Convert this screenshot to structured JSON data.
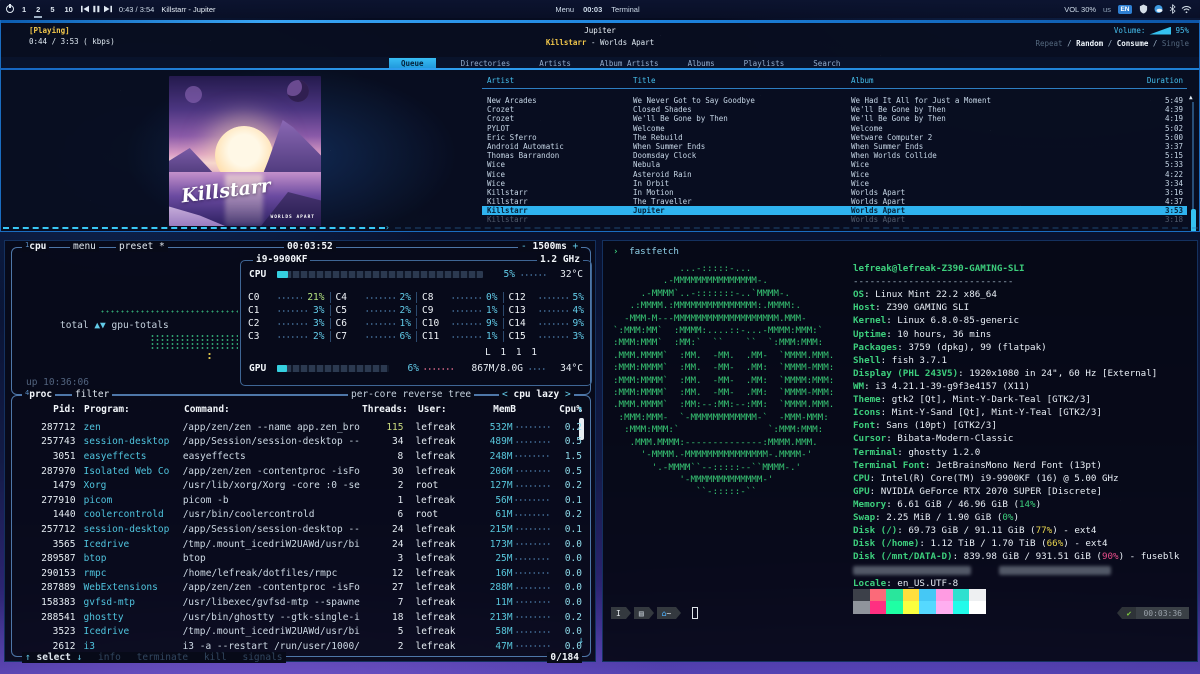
{
  "colors": {
    "accent_blue": "#2f9ff0",
    "cyan": "#46c0ee",
    "yellow": "#f3c84b",
    "mint_green": "#3dcf7d",
    "selected_row_bg": "#2fb3ef"
  },
  "topbar": {
    "workspaces": [
      "1",
      "2",
      "5",
      "10"
    ],
    "active_workspace": "2",
    "media_time": "0:43 / 3:54",
    "media_track": "Killstarr - Jupiter",
    "menu_label": "Menu",
    "clock": "00:03",
    "focused_window": "Terminal",
    "volume_label": "VOL 30%",
    "kb_layout": "us",
    "lang_badge": "EN"
  },
  "player": {
    "status": "[Playing]",
    "elapsed": "0:44 / 3:53 ( kbps)",
    "title": "Jupiter",
    "artist": "Killstarr",
    "separator": " - ",
    "album": "Worlds Apart",
    "volume_label": "Volume:",
    "volume_value": "95%",
    "toggles": [
      {
        "label": "Repeat",
        "active": false
      },
      {
        "label": "Random",
        "active": true
      },
      {
        "label": "Consume",
        "active": true
      },
      {
        "label": "Single",
        "active": false
      }
    ],
    "tabs": [
      {
        "label": "Queue",
        "selected": true
      },
      {
        "label": "Directories",
        "selected": false
      },
      {
        "label": "Artists",
        "selected": false
      },
      {
        "label": "Album Artists",
        "selected": false
      },
      {
        "label": "Albums",
        "selected": false
      },
      {
        "label": "Playlists",
        "selected": false
      },
      {
        "label": "Search",
        "selected": false
      }
    ],
    "columns": [
      "Artist",
      "Title",
      "Album",
      "Duration"
    ],
    "rows": [
      {
        "artist": "New Arcades",
        "title": "We Never Got to Say Goodbye",
        "album": "We Had It All for Just a Moment",
        "duration": "5:49",
        "selected": false,
        "partial": false
      },
      {
        "artist": "Crozet",
        "title": "Closed Shades",
        "album": "We'll Be Gone by Then",
        "duration": "4:39",
        "selected": false,
        "partial": false
      },
      {
        "artist": "Crozet",
        "title": "We'll Be Gone by Then",
        "album": "We'll Be Gone by Then",
        "duration": "4:19",
        "selected": false,
        "partial": false
      },
      {
        "artist": "PYLOT",
        "title": "Welcome",
        "album": "Welcome",
        "duration": "5:02",
        "selected": false,
        "partial": false
      },
      {
        "artist": "Eric Sferro",
        "title": "The Rebuild",
        "album": "Wetware Computer 2",
        "duration": "5:00",
        "selected": false,
        "partial": false
      },
      {
        "artist": "Android Automatic",
        "title": "When Summer Ends",
        "album": "When Summer Ends",
        "duration": "3:37",
        "selected": false,
        "partial": false
      },
      {
        "artist": "Thomas Barrandon",
        "title": "Doomsday Clock",
        "album": "When Worlds Collide",
        "duration": "5:15",
        "selected": false,
        "partial": false
      },
      {
        "artist": "Wice",
        "title": "Nebula",
        "album": "Wice",
        "duration": "5:33",
        "selected": false,
        "partial": false
      },
      {
        "artist": "Wice",
        "title": "Asteroid Rain",
        "album": "Wice",
        "duration": "4:22",
        "selected": false,
        "partial": false
      },
      {
        "artist": "Wice",
        "title": "In Orbit",
        "album": "Wice",
        "duration": "3:34",
        "selected": false,
        "partial": false
      },
      {
        "artist": "Killstarr",
        "title": "In Motion",
        "album": "Worlds Apart",
        "duration": "3:16",
        "selected": false,
        "partial": false
      },
      {
        "artist": "Killstarr",
        "title": "The Traveller",
        "album": "Worlds Apart",
        "duration": "4:37",
        "selected": false,
        "partial": false
      },
      {
        "artist": "Killstarr",
        "title": "Jupiter",
        "album": "Worlds Apart",
        "duration": "3:53",
        "selected": true,
        "partial": false
      },
      {
        "artist": "Killstarr",
        "title": "",
        "album": "Worlds Apart",
        "duration": "3:18",
        "selected": false,
        "partial": true
      }
    ],
    "art": {
      "script": "Killstarr",
      "caption": "WORLDS APART"
    }
  },
  "btop": {
    "cpu_box": {
      "index": "1",
      "title": "cpu",
      "menu": "menu",
      "preset": "preset *",
      "clock": "00:03:52",
      "interval_minus": "-",
      "interval": "1500ms",
      "interval_plus": "+",
      "model": "i9-9900KF",
      "freq": "1.2 GHz",
      "cpu_label": "CPU",
      "cpu_pct": "5%",
      "cpu_temp": "32°C",
      "core_rows": [
        [
          {
            "n": "C0",
            "p": "21%"
          },
          {
            "n": "C4",
            "p": "2%"
          },
          {
            "n": "C8",
            "p": "0%"
          },
          {
            "n": "C12",
            "p": "5%"
          }
        ],
        [
          {
            "n": "C1",
            "p": "3%"
          },
          {
            "n": "C5",
            "p": "2%"
          },
          {
            "n": "C9",
            "p": "1%"
          },
          {
            "n": "C13",
            "p": "4%"
          }
        ],
        [
          {
            "n": "C2",
            "p": "3%"
          },
          {
            "n": "C6",
            "p": "1%"
          },
          {
            "n": "C10",
            "p": "9%"
          },
          {
            "n": "C14",
            "p": "9%"
          }
        ],
        [
          {
            "n": "C3",
            "p": "2%"
          },
          {
            "n": "C7",
            "p": "6%"
          },
          {
            "n": "C11",
            "p": "1%"
          },
          {
            "n": "C15",
            "p": "3%"
          }
        ]
      ],
      "load_avg": "L 1 1 1",
      "gpu_label": "GPU",
      "gpu_pct": "6%",
      "gpu_mem": "867M/8.0G",
      "gpu_temp": "34°C",
      "graph_label_pre": "total ",
      "graph_arrows": "▲▼",
      "graph_label_post": " gpu-totals",
      "uptime": "up 10:36:06"
    },
    "proc_box": {
      "index": "4",
      "title": "proc",
      "filter": "filter",
      "options": "per-core   reverse   tree",
      "sort_prev": "<",
      "sort": "cpu lazy",
      "sort_next": ">",
      "sort_arrow": "↑",
      "columns": {
        "pid": "Pid:",
        "program": "Program:",
        "command": "Command:",
        "threads": "Threads:",
        "user": "User:",
        "mem": "MemB",
        "cpu": "Cpu%"
      },
      "rows": [
        {
          "pid": "287712",
          "prog": "zen",
          "cmd": "/app/zen/zen --name app.zen_bro",
          "thr": "115",
          "user": "lefreak",
          "mem": "532M",
          "cpu": "0.2"
        },
        {
          "pid": "257743",
          "prog": "session-desktop",
          "cmd": "/app/Session/session-desktop --",
          "thr": "34",
          "user": "lefreak",
          "mem": "489M",
          "cpu": "0.5"
        },
        {
          "pid": "3051",
          "prog": "easyeffects",
          "cmd": "easyeffects",
          "thr": "8",
          "user": "lefreak",
          "mem": "248M",
          "cpu": "1.5"
        },
        {
          "pid": "287970",
          "prog": "Isolated Web Co",
          "cmd": "/app/zen/zen -contentproc -isFo",
          "thr": "30",
          "user": "lefreak",
          "mem": "206M",
          "cpu": "0.5"
        },
        {
          "pid": "1479",
          "prog": "Xorg",
          "cmd": "/usr/lib/xorg/Xorg -core :0 -se",
          "thr": "2",
          "user": "root",
          "mem": "127M",
          "cpu": "0.2"
        },
        {
          "pid": "277910",
          "prog": "picom",
          "cmd": "picom -b",
          "thr": "1",
          "user": "lefreak",
          "mem": "56M",
          "cpu": "0.1"
        },
        {
          "pid": "1440",
          "prog": "coolercontrold",
          "cmd": "/usr/bin/coolercontrold",
          "thr": "6",
          "user": "root",
          "mem": "61M",
          "cpu": "0.2"
        },
        {
          "pid": "257712",
          "prog": "session-desktop",
          "cmd": "/app/Session/session-desktop --",
          "thr": "24",
          "user": "lefreak",
          "mem": "215M",
          "cpu": "0.1"
        },
        {
          "pid": "3565",
          "prog": "Icedrive",
          "cmd": "/tmp/.mount_icedriW2UAWd/usr/bi",
          "thr": "24",
          "user": "lefreak",
          "mem": "173M",
          "cpu": "0.0"
        },
        {
          "pid": "289587",
          "prog": "btop",
          "cmd": "btop",
          "thr": "3",
          "user": "lefreak",
          "mem": "25M",
          "cpu": "0.0"
        },
        {
          "pid": "290153",
          "prog": "rmpc",
          "cmd": "/home/lefreak/dotfiles/rmpc",
          "thr": "12",
          "user": "lefreak",
          "mem": "16M",
          "cpu": "0.0"
        },
        {
          "pid": "287889",
          "prog": "WebExtensions",
          "cmd": "/app/zen/zen -contentproc -isFo",
          "thr": "27",
          "user": "lefreak",
          "mem": "288M",
          "cpu": "0.0"
        },
        {
          "pid": "158383",
          "prog": "gvfsd-mtp",
          "cmd": "/usr/libexec/gvfsd-mtp --spawne",
          "thr": "7",
          "user": "lefreak",
          "mem": "11M",
          "cpu": "0.0"
        },
        {
          "pid": "288541",
          "prog": "ghostty",
          "cmd": "/usr/bin/ghostty --gtk-single-i",
          "thr": "18",
          "user": "lefreak",
          "mem": "213M",
          "cpu": "0.2"
        },
        {
          "pid": "3523",
          "prog": "Icedrive",
          "cmd": "/tmp/.mount_icedriW2UAWd/usr/bi",
          "thr": "5",
          "user": "lefreak",
          "mem": "58M",
          "cpu": "0.0"
        },
        {
          "pid": "2612",
          "prog": "i3",
          "cmd": "i3 -a --restart /run/user/1000/",
          "thr": "2",
          "user": "lefreak",
          "mem": "47M",
          "cpu": "0.0"
        }
      ],
      "footer": {
        "up": "↑",
        "select": "select",
        "down": "↓",
        "actions": [
          "info",
          "terminate",
          "kill",
          "signals"
        ],
        "count": "0/184"
      }
    }
  },
  "fastfetch": {
    "prompt_symbol": "›",
    "prompt_cmd": "fastfetch",
    "logo_lines": [
      "            ...-:::::-...",
      "         .-MMMMMMMMMMMMMMM-.",
      "     .-MMMM`..-:::::::-..`MMMM-.",
      "   .:MMMM.:MMMMMMMMMMMMMMM:.MMMM:.",
      "  -MMM-M---MMMMMMMMMMMMMMMMMMM.MMM-",
      "`:MMM:MM`  :MMMM:....::-...-MMMM:MMM:`",
      ":MMM:MMM`  :MM:`  ``    ``  `:MMM:MMM:",
      ".MMM.MMMM`  :MM.  -MM.  .MM-  `MMMM.MMM.",
      ":MMM:MMMM`  :MM.  -MM-  .MM:  `MMMM-MMM:",
      ":MMM:MMMM`  :MM.  -MM-  .MM:  `MMMM:MMM:",
      ":MMM:MMMM`  :MM.  -MM-  .MM:  `MMMM-MMM:",
      ".MMM.MMMM`  :MM:--:MM:--:MM:  `MMMM.MMM.",
      " :MMM:MMM-  `-MMMMMMMMMMMM-`  -MMM-MMM:",
      "  :MMM:MMM:`                `:MMM:MMM:",
      "   .MMM.MMMM:--------------:MMMM.MMM.",
      "     '-MMMM.-MMMMMMMMMMMMMMM-.MMMM-'",
      "       '.-MMMM``--:::::--``MMMM-.'",
      "            '-MMMMMMMMMMMMM-'",
      "               ``-:::::-``"
    ],
    "info": [
      {
        "type": "title",
        "text": "lefreak@lefreak-Z390-GAMING-SLI"
      },
      {
        "type": "sep",
        "text": "-----------------------------"
      },
      {
        "key": "OS",
        "value": "Linux Mint 22.2 x86_64"
      },
      {
        "key": "Host",
        "value": "Z390 GAMING SLI"
      },
      {
        "key": "Kernel",
        "value": "Linux 6.8.0-85-generic"
      },
      {
        "key": "Uptime",
        "value": "10 hours, 36 mins"
      },
      {
        "key": "Packages",
        "value": "3759 (dpkg), 99 (flatpak)"
      },
      {
        "key": "Shell",
        "value": "fish 3.7.1"
      },
      {
        "key": "Display (PHL 243V5)",
        "value": "1920x1080 in 24\", 60 Hz [External]"
      },
      {
        "key": "WM",
        "value": "i3 4.21.1-39-g9f3e4157 (X11)"
      },
      {
        "key": "Theme",
        "value": "gtk2 [Qt], Mint-Y-Dark-Teal [GTK2/3]"
      },
      {
        "key": "Icons",
        "value": "Mint-Y-Sand [Qt], Mint-Y-Teal [GTK2/3]"
      },
      {
        "key": "Font",
        "value": "Sans (10pt) [GTK2/3]"
      },
      {
        "key": "Cursor",
        "value": "Bibata-Modern-Classic"
      },
      {
        "key": "Terminal",
        "value": "ghostty 1.2.0"
      },
      {
        "key": "Terminal Font",
        "value": "JetBrainsMono Nerd Font (13pt)"
      },
      {
        "key": "CPU",
        "value": "Intel(R) Core(TM) i9-9900KF (16) @ 5.00 GHz"
      },
      {
        "key": "GPU",
        "value": "NVIDIA GeForce RTX 2070 SUPER [Discrete]"
      },
      {
        "key": "Memory",
        "pre": "6.61 GiB / 46.96 GiB (",
        "pct": "14%",
        "pct_color": "green",
        "post": ")"
      },
      {
        "key": "Swap",
        "pre": "2.25 MiB / 1.90 GiB (",
        "pct": "0%",
        "pct_color": "green",
        "post": ")"
      },
      {
        "key": "Disk (/)",
        "pre": "69.73 GiB / 91.11 GiB (",
        "pct": "77%",
        "pct_color": "yellow",
        "post": ") - ext4"
      },
      {
        "key": "Disk (/home)",
        "pre": "1.12 TiB / 1.70 TiB (",
        "pct": "66%",
        "pct_color": "yellow",
        "post": ") - ext4"
      },
      {
        "key": "Disk (/mnt/DATA-D)",
        "pre": "839.98 GiB / 931.51 GiB (",
        "pct": "90%",
        "pct_color": "magenta",
        "post": ") - fuseblk"
      },
      {
        "type": "redacted"
      },
      {
        "key": "Locale",
        "value": "en_US.UTF-8"
      }
    ],
    "palette_dim": [
      "#3c4049",
      "#fb6a79",
      "#29e69c",
      "#ffdf3d",
      "#45c8f5",
      "#ff9be2",
      "#2fe0cf",
      "#eef0f2"
    ],
    "palette_bright": [
      "#8f949c",
      "#ff2f81",
      "#1effa4",
      "#fbff3f",
      "#55d9ff",
      "#ffaef0",
      "#22fbea",
      "#ffffff"
    ],
    "prompt": {
      "mode": "I",
      "pkg_icon": "▤",
      "home_icon": "⌂",
      "home_suffix": "~",
      "check": "✔",
      "time": "00:03:36"
    }
  }
}
